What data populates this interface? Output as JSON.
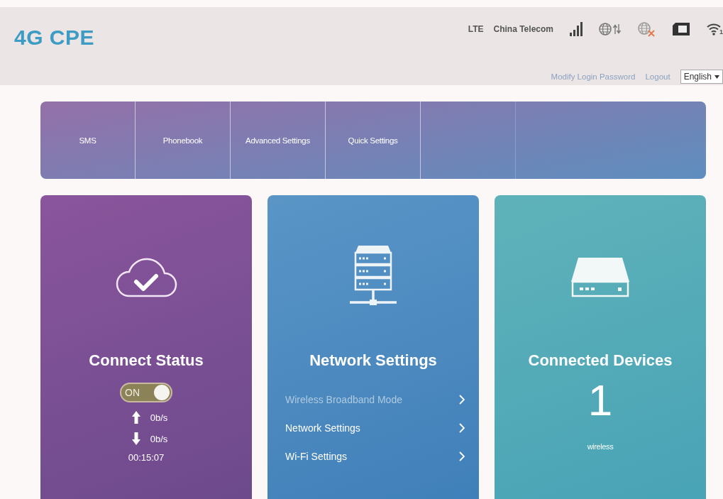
{
  "header": {
    "logo": "4G CPE",
    "network_type": "LTE",
    "carrier": "China Telecom",
    "wifi_count": "1",
    "links": [
      "Modify Login Password",
      "Logout"
    ],
    "language": "English"
  },
  "nav": {
    "tabs": [
      "SMS",
      "Phonebook",
      "Advanced Settings",
      "Quick Settings"
    ]
  },
  "cards": [
    {
      "kind": "status",
      "title": "Connect Status",
      "toggle": {
        "label": "ON",
        "on": true
      },
      "upload": "0b/s",
      "download": "0b/s",
      "duration": "00:15:07"
    },
    {
      "kind": "network",
      "title": "Network Settings",
      "links": [
        {
          "label": "Wireless Broadband Mode",
          "disabled": true
        },
        {
          "label": "Network Settings",
          "disabled": false
        },
        {
          "label": "Wi-Fi Settings",
          "disabled": false
        }
      ]
    },
    {
      "kind": "devices",
      "title": "Connected Devices",
      "count": "1",
      "caption": "wireless"
    }
  ]
}
